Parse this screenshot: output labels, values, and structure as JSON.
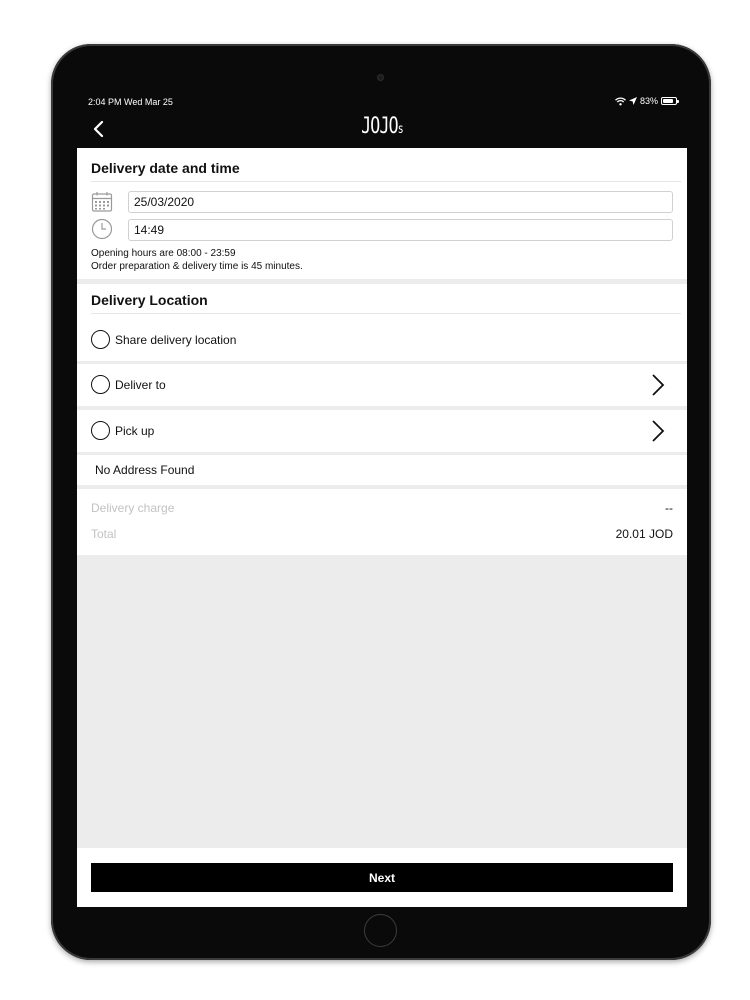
{
  "status_bar": {
    "time": "2:04 PM  Wed Mar 25",
    "battery": "83%"
  },
  "nav": {
    "logo_main": "JOJO",
    "logo_suffix": "s"
  },
  "delivery_datetime": {
    "title": "Delivery date and time",
    "date_value": "25/03/2020",
    "time_value": "14:49",
    "opening_hours": "Opening hours are  08:00 - 23:59",
    "prep_time": "Order preparation & delivery time is  45 minutes."
  },
  "delivery_location": {
    "title": "Delivery Location",
    "options": [
      {
        "label": "Share delivery location"
      },
      {
        "label": "Deliver to"
      },
      {
        "label": "Pick up"
      }
    ],
    "no_address": "No Address Found"
  },
  "summary": {
    "delivery_charge_label": "Delivery charge",
    "delivery_charge_value": "--",
    "total_label": "Total",
    "total_value": "20.01 JOD"
  },
  "footer": {
    "next_label": "Next"
  },
  "colors": {
    "accent": "#000000",
    "background": "#ececec",
    "muted_text": "#c2c2c2"
  }
}
